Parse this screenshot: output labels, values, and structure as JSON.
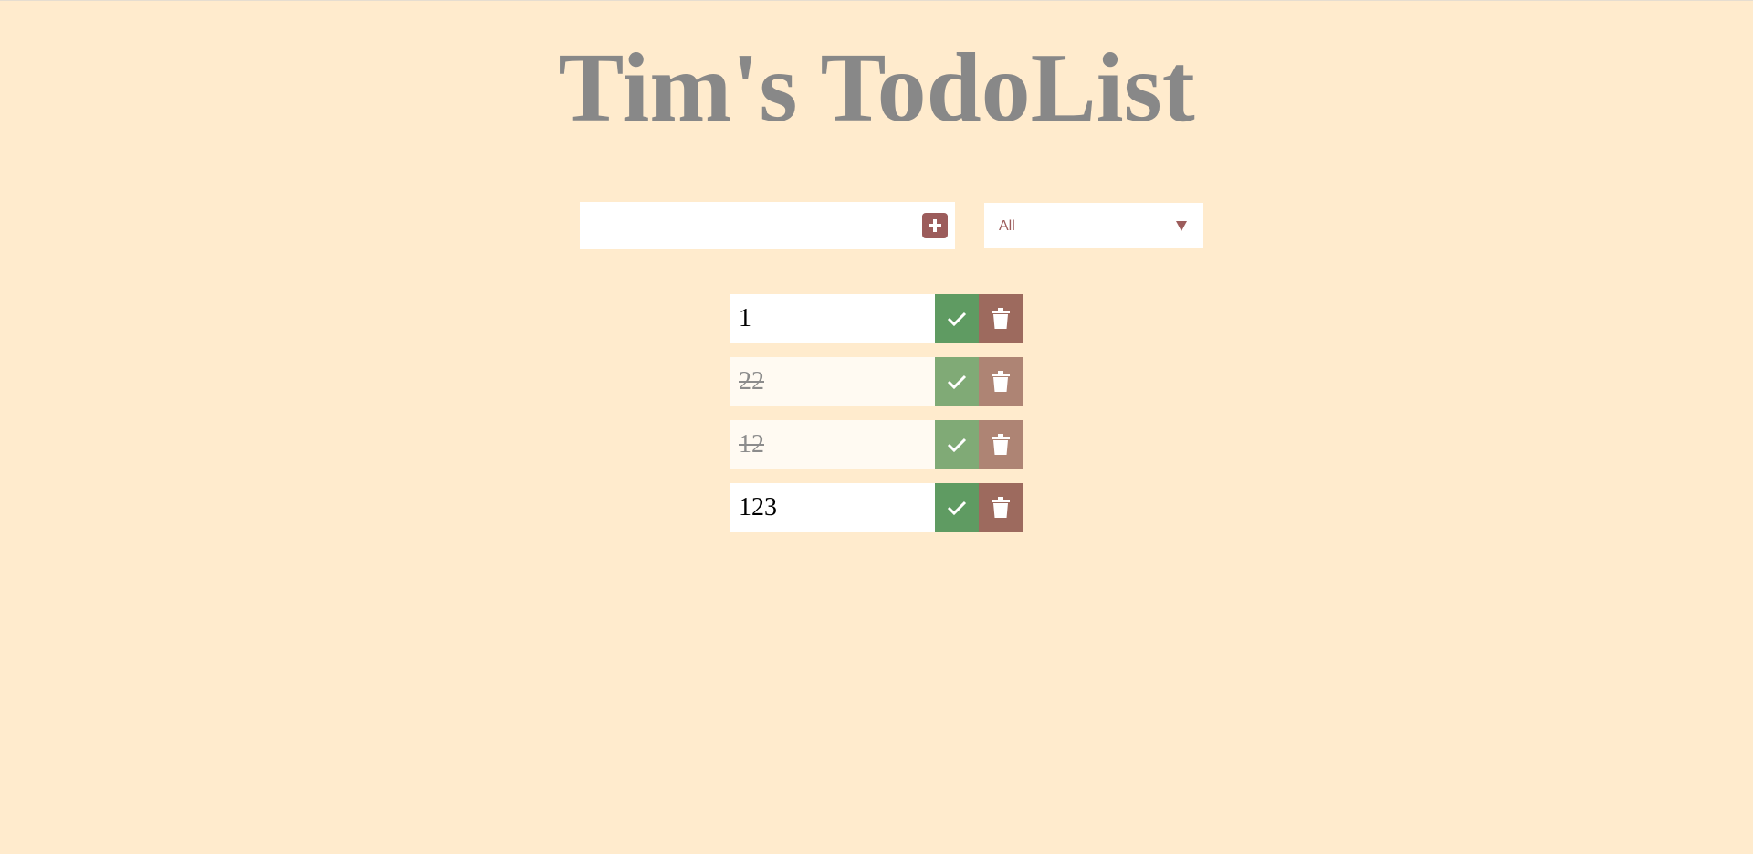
{
  "header": {
    "title": "Tim's TodoList"
  },
  "form": {
    "input_value": "",
    "input_placeholder": "",
    "add_icon": "plus-square-icon"
  },
  "filter": {
    "selected": "All",
    "icon": "chevron-down-icon"
  },
  "todos": [
    {
      "text": "1",
      "completed": false
    },
    {
      "text": "22",
      "completed": true
    },
    {
      "text": "12",
      "completed": true
    },
    {
      "text": "123",
      "completed": false
    }
  ],
  "icons": {
    "complete": "check-icon",
    "delete": "trash-icon"
  },
  "colors": {
    "background": "#ffebcd",
    "title": "#888888",
    "accent": "#9c5c5b",
    "complete_button": "#5f9b62",
    "delete_button": "#9d6a5e"
  }
}
